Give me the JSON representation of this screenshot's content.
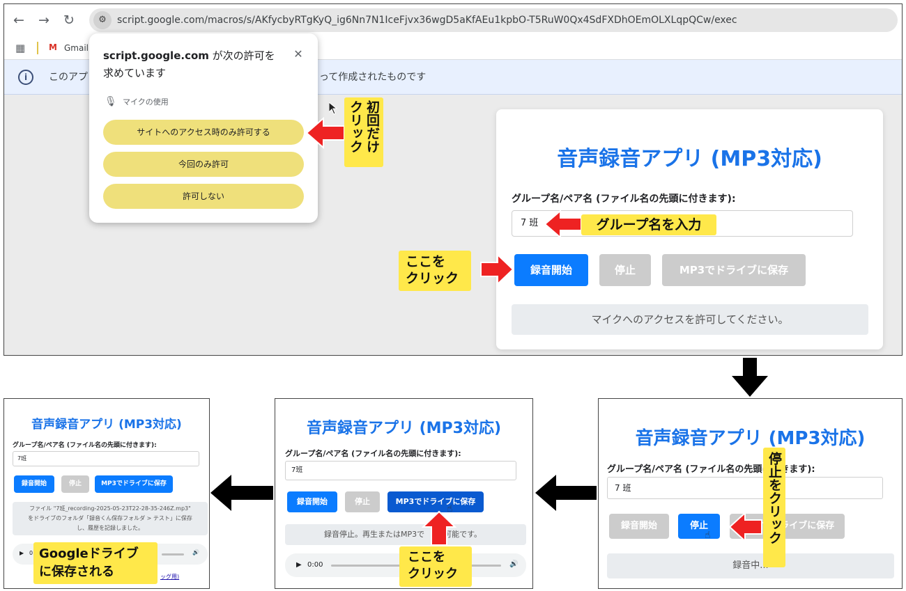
{
  "browser": {
    "url": "script.google.com/macros/s/AKfycbyRTgKyQ_ig6Nn7N1IceFjvx36wgD5aKfAEu1kpbO-T5RuW0Qx4SdFXDhOEmOLXLqpQCw/exec",
    "bookmark_gmail": "Gmail",
    "infobar_left": "このアプ",
    "infobar_right": "って作成されたものです"
  },
  "permission": {
    "site": "script.google.com",
    "title_suffix": " が次の許可を",
    "title_line2": "求めています",
    "mic_label": "マイクの使用",
    "btn_allow_visit": "サイトへのアクセス時のみ許可する",
    "btn_allow_once": "今回のみ許可",
    "btn_deny": "許可しない"
  },
  "app": {
    "title": "音声録音アプリ (MP3対応)",
    "label": "グループ名/ペア名 (ファイル名の先頭に付きます):",
    "input_value": "7 班",
    "input_value_short": "7班",
    "btn_record": "録音開始",
    "btn_stop": "停止",
    "btn_save": "MP3でドライブに保存",
    "status_allow": "マイクへのアクセスを許可してください。",
    "status_recording": "録音中...",
    "status_stopped": "録音停止。再生またはMP3で",
    "status_stopped_tail": "可能です。",
    "saved_line1": "ファイル \"7班_recording-2025-05-23T22-28-35-246Z.mp3\"",
    "saved_line2": "をドライブのフォルダ「録音くん保存フォルダ > テスト」に保存",
    "saved_line3": "し、履歴を記録しました。",
    "audio_time": "0:00",
    "audio_time_partial": "0",
    "link_partial": "ッグ用)"
  },
  "annotations": {
    "first_click": "初回だけクリック",
    "enter_group": "グループ名を入力",
    "click_here_line1": "ここを",
    "click_here_line2": "クリック",
    "stop_click": "停止をクリック",
    "saved_line1": "Googleドライブ",
    "saved_line2": "に保存される"
  },
  "colors": {
    "accent_blue": "#1a73e8",
    "button_blue": "#0b7cff",
    "annotation_yellow": "#ffe84a",
    "arrow_red": "#ee2222",
    "permission_yellow": "#efe07b"
  }
}
